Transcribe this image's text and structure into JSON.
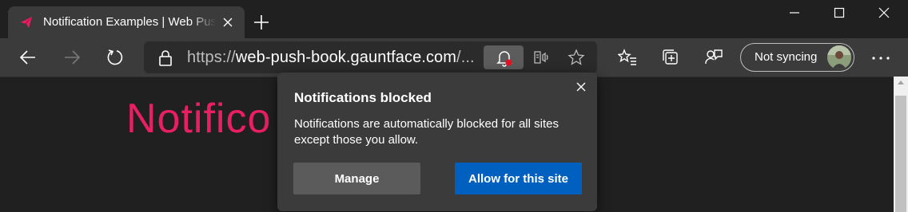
{
  "colors": {
    "accent": "#0060c0",
    "heading": "#e91e63",
    "notification_badge": "#e81123"
  },
  "tab": {
    "title": "Notification Examples | Web Push Book",
    "favicon": "paper-plane-icon"
  },
  "address_bar": {
    "scheme": "https://",
    "host": "web-push-book.gauntface.com",
    "rest": "/..."
  },
  "profile": {
    "sync_label": "Not syncing"
  },
  "page": {
    "heading": "Notifico"
  },
  "popup": {
    "title": "Notifications blocked",
    "message": "Notifications are automatically blocked for all sites except those you allow.",
    "manage_label": "Manage",
    "allow_label": "Allow for this site"
  }
}
